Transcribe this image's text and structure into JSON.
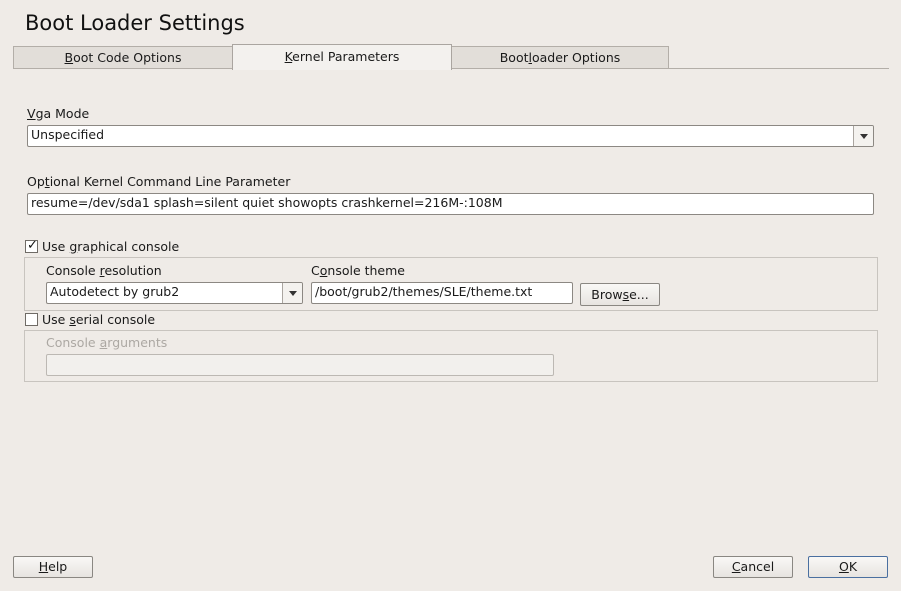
{
  "window": {
    "title": "Boot Loader Settings"
  },
  "tabs": [
    {
      "label": "Boot Code Options",
      "mnemonic_before": "",
      "mnemonic": "B",
      "mnemonic_after": "oot Code Options"
    },
    {
      "label": "Kernel Parameters",
      "mnemonic_before": "",
      "mnemonic": "K",
      "mnemonic_after": "ernel Parameters"
    },
    {
      "label": "Bootloader Options",
      "mnemonic_before": "Boot",
      "mnemonic": "l",
      "mnemonic_after": "oader Options"
    }
  ],
  "vga_mode": {
    "label_mnemonic": "V",
    "label_rest": "ga Mode",
    "value": "Unspecified"
  },
  "kernel_cmdline": {
    "label_before": "Op",
    "label_mnemonic": "t",
    "label_after": "ional Kernel Command Line Parameter",
    "value": "resume=/dev/sda1 splash=silent quiet showopts crashkernel=216M-:108M"
  },
  "graphical_console": {
    "label_before": "Use ",
    "label_mnemonic": "g",
    "label_after": "raphical console",
    "checked": true,
    "check_glyph": "✓",
    "resolution_label_before": "Console ",
    "resolution_label_mnemonic": "r",
    "resolution_label_after": "esolution",
    "resolution_value": "Autodetect by grub2",
    "theme_label_before": "C",
    "theme_label_mnemonic": "o",
    "theme_label_after": "nsole theme",
    "theme_value": "/boot/grub2/themes/SLE/theme.txt",
    "browse_before": "Brow",
    "browse_mnemonic": "s",
    "browse_after": "e..."
  },
  "serial_console": {
    "label_before": "Use ",
    "label_mnemonic": "s",
    "label_after": "erial console",
    "checked": false,
    "args_label_before": "Console ",
    "args_label_mnemonic": "a",
    "args_label_after": "rguments",
    "args_value": ""
  },
  "footer": {
    "help_mnemonic": "H",
    "help_rest": "elp",
    "cancel_mnemonic": "C",
    "cancel_rest": "ancel",
    "ok_mnemonic": "O",
    "ok_rest": "K"
  },
  "colors": {
    "background": "#efebe7",
    "default_button_border": "#4a6fa0"
  }
}
